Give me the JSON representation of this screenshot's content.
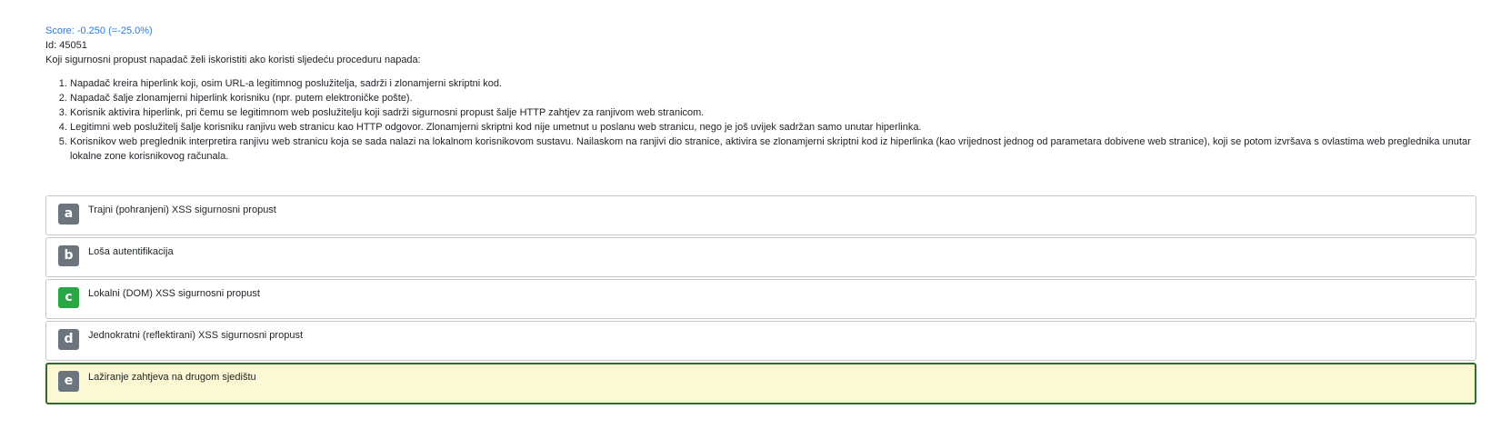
{
  "header": {
    "score": "Score: -0.250 (=-25.0%)",
    "id": "Id: 45051",
    "question": "Koji sigurnosni propust napadač želi iskoristiti ako koristi sljedeću proceduru napada:"
  },
  "steps": [
    "Napadač kreira hiperlink koji, osim URL-a legitimnog poslužitelja, sadrži i zlonamjerni skriptni kod.",
    "Napadač šalje zlonamjerni hiperlink korisniku (npr. putem elektroničke pošte).",
    "Korisnik aktivira hiperlink, pri čemu se legitimnom web poslužitelju koji sadrži sigurnosni propust šalje HTTP zahtjev za ranjivom web stranicom.",
    "Legitimni web poslužitelj šalje korisniku ranjivu web stranicu kao HTTP odgovor. Zlonamjerni skriptni kod nije umetnut u poslanu web stranicu, nego je još uvijek sadržan samo unutar hiperlinka.",
    "Korisnikov web preglednik interpretira ranjivu web stranicu koja se sada nalazi na lokalnom korisnikovom sustavu. Nailaskom na ranjivi dio stranice, aktivira se zlonamjerni skriptni kod iz hiperlinka (kao vrijednost jednog od parametara dobivene web stranice), koji se potom izvršava s ovlastima web preglednika unutar lokalne zone korisnikovog računala."
  ],
  "answers": [
    {
      "letter": "a",
      "text": "Trajni (pohranjeni) XSS sigurnosni propust",
      "state": "normal"
    },
    {
      "letter": "b",
      "text": "Loša autentifikacija",
      "state": "normal"
    },
    {
      "letter": "c",
      "text": "Lokalni (DOM) XSS sigurnosni propust",
      "state": "correct"
    },
    {
      "letter": "d",
      "text": "Jednokratni (reflektirani) XSS sigurnosni propust",
      "state": "normal"
    },
    {
      "letter": "e",
      "text": "Lažiranje zahtjeva na drugom sjedištu",
      "state": "selected"
    }
  ],
  "colors": {
    "score": "#2a7ae2",
    "badge_default": "#6c757d",
    "badge_correct": "#28a745",
    "selected_bg": "#fbf8d3",
    "selected_border": "#2f6b2f"
  }
}
